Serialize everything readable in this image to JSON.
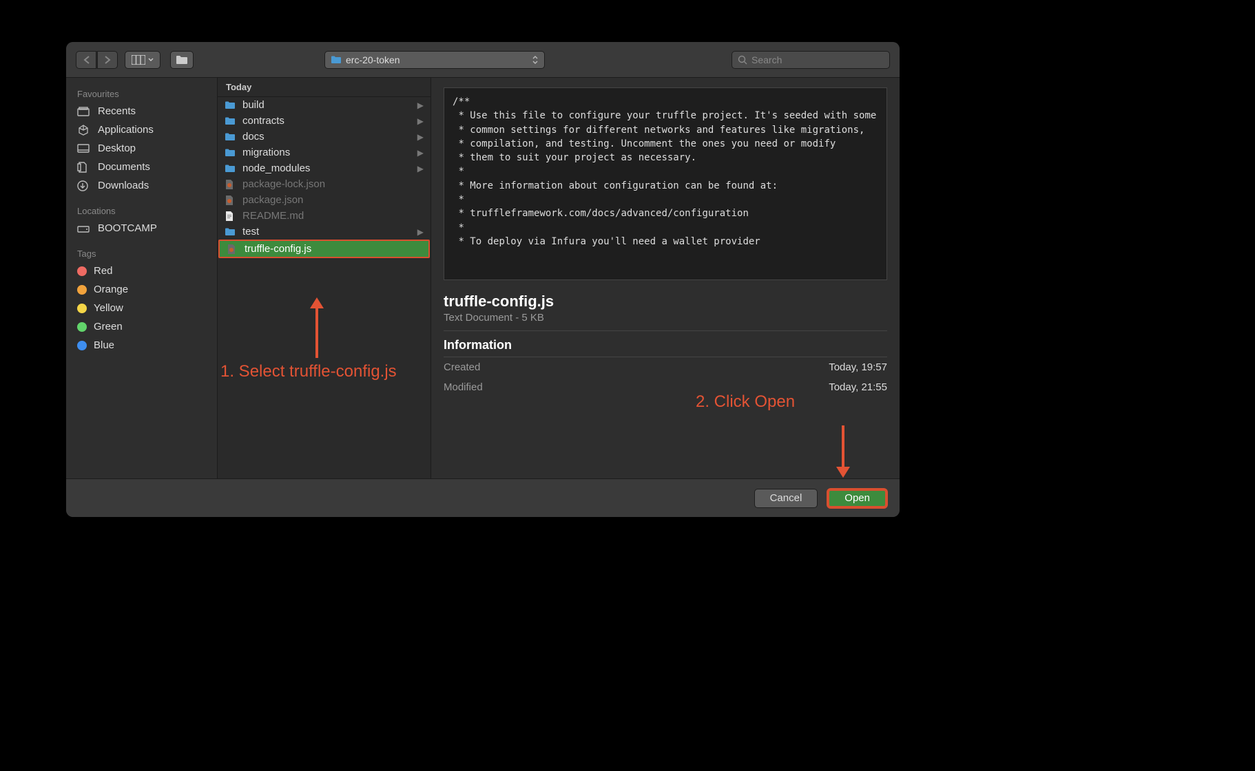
{
  "toolbar": {
    "current_folder": "erc-20-token",
    "search_placeholder": "Search"
  },
  "sidebar": {
    "sections": [
      {
        "header": "Favourites",
        "items": [
          {
            "label": "Recents",
            "icon": "recents"
          },
          {
            "label": "Applications",
            "icon": "applications"
          },
          {
            "label": "Desktop",
            "icon": "desktop"
          },
          {
            "label": "Documents",
            "icon": "documents"
          },
          {
            "label": "Downloads",
            "icon": "downloads"
          }
        ]
      },
      {
        "header": "Locations",
        "items": [
          {
            "label": "BOOTCAMP",
            "icon": "disk"
          }
        ]
      },
      {
        "header": "Tags",
        "items": [
          {
            "label": "Red",
            "color": "#ef6b63"
          },
          {
            "label": "Orange",
            "color": "#f2a33c"
          },
          {
            "label": "Yellow",
            "color": "#f5d547"
          },
          {
            "label": "Green",
            "color": "#62d46b"
          },
          {
            "label": "Blue",
            "color": "#3e8ef0"
          }
        ]
      }
    ]
  },
  "file_column": {
    "header": "Today",
    "items": [
      {
        "name": "build",
        "type": "folder",
        "dimmed": false
      },
      {
        "name": "contracts",
        "type": "folder",
        "dimmed": false
      },
      {
        "name": "docs",
        "type": "folder",
        "dimmed": false
      },
      {
        "name": "migrations",
        "type": "folder",
        "dimmed": false
      },
      {
        "name": "node_modules",
        "type": "folder",
        "dimmed": false
      },
      {
        "name": "package-lock.json",
        "type": "file",
        "dimmed": true
      },
      {
        "name": "package.json",
        "type": "file",
        "dimmed": true
      },
      {
        "name": "README.md",
        "type": "file",
        "dimmed": true
      },
      {
        "name": "test",
        "type": "folder",
        "dimmed": false
      },
      {
        "name": "truffle-config.js",
        "type": "file",
        "dimmed": false,
        "selected": true
      }
    ]
  },
  "preview": {
    "code": "/**\n * Use this file to configure your truffle project. It's seeded with some\n * common settings for different networks and features like migrations,\n * compilation, and testing. Uncomment the ones you need or modify\n * them to suit your project as necessary.\n *\n * More information about configuration can be found at:\n *\n * truffleframework.com/docs/advanced/configuration\n *\n * To deploy via Infura you'll need a wallet provider",
    "title": "truffle-config.js",
    "subtitle": "Text Document - 5 KB",
    "info_header": "Information",
    "rows": [
      {
        "label": "Created",
        "value": "Today, 19:57"
      },
      {
        "label": "Modified",
        "value": "Today, 21:55"
      }
    ]
  },
  "footer": {
    "cancel": "Cancel",
    "open": "Open"
  },
  "annotations": {
    "step1": "1. Select truffle-config.js",
    "step2": "2. Click Open"
  }
}
